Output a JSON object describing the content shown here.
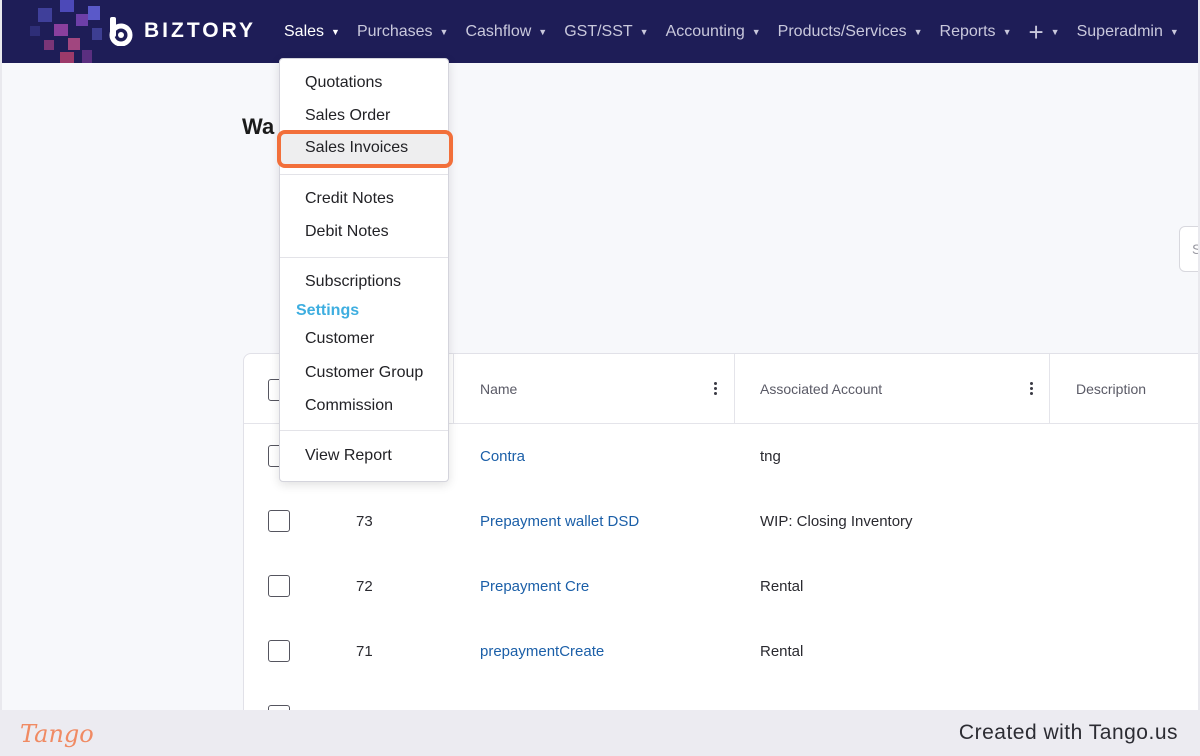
{
  "app": {
    "brand": "BIZTORY"
  },
  "nav": {
    "items": [
      {
        "label": "Sales",
        "active": true
      },
      {
        "label": "Purchases"
      },
      {
        "label": "Cashflow"
      },
      {
        "label": "GST/SST"
      },
      {
        "label": "Accounting"
      },
      {
        "label": "Products/Services"
      },
      {
        "label": "Reports"
      },
      {
        "label": "+"
      },
      {
        "label": "Superadmin"
      }
    ]
  },
  "page": {
    "title": "Wa",
    "search_placeholder": "S"
  },
  "sales_menu": {
    "items": [
      "Quotations",
      "Sales Order",
      "Sales Invoices",
      "Credit Notes",
      "Debit Notes",
      "Subscriptions",
      "Customer",
      "Customer Group",
      "Commission",
      "View Report"
    ],
    "settings_heading": "Settings",
    "highlighted": "Sales Invoices"
  },
  "table": {
    "columns": [
      "Name",
      "Associated Account",
      "Description"
    ],
    "rows": [
      {
        "id": "",
        "name": "Contra",
        "account": "tng"
      },
      {
        "id": "73",
        "name": "Prepayment wallet DSD",
        "account": "WIP: Closing Inventory"
      },
      {
        "id": "72",
        "name": "Prepayment Cre",
        "account": "Rental"
      },
      {
        "id": "71",
        "name": "prepaymentCreate",
        "account": "Rental"
      }
    ]
  },
  "footer": {
    "tango": "Tango",
    "created_with": "Created with Tango.us"
  },
  "colors": {
    "nav_bg": "#1e1d57",
    "link": "#1b5fa8",
    "highlight": "#f26f3a",
    "settings": "#3eaee0"
  }
}
